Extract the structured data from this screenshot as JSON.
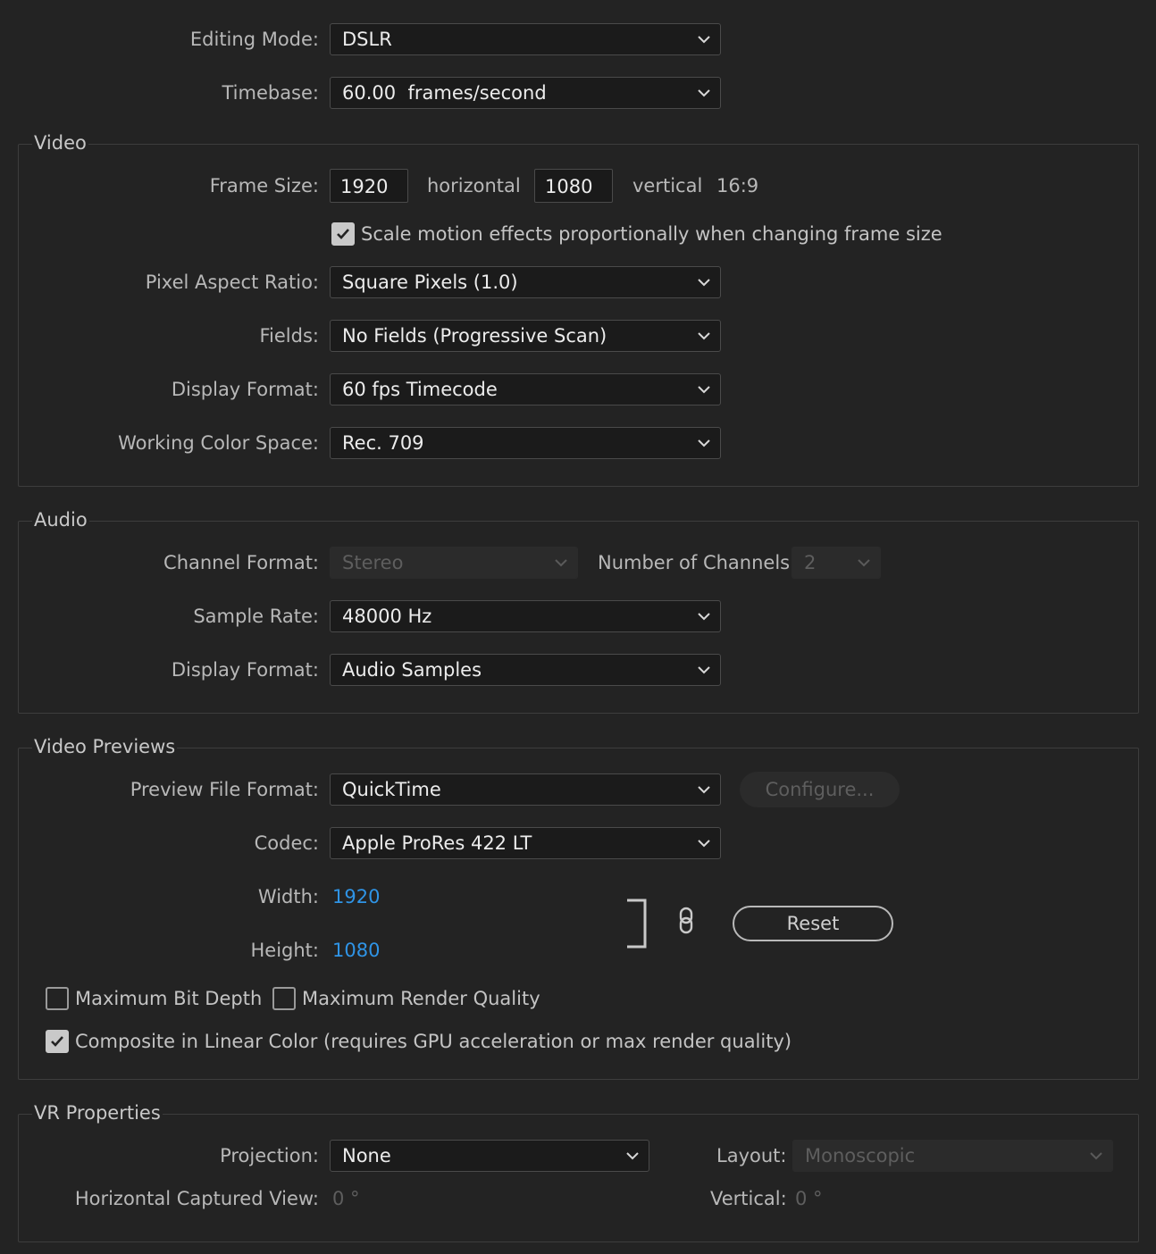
{
  "general": {
    "editing_mode_label": "Editing Mode:",
    "editing_mode_value": "DSLR",
    "timebase_label": "Timebase:",
    "timebase_value": "60.00  frames/second"
  },
  "video": {
    "title": "Video",
    "frame_size_label": "Frame Size:",
    "frame_width": "1920",
    "horizontal_label": "horizontal",
    "frame_height": "1080",
    "vertical_label": "vertical",
    "aspect_ratio": "16:9",
    "scale_motion_label": "Scale motion effects proportionally when changing frame size",
    "scale_motion_checked": true,
    "pixel_aspect_label": "Pixel Aspect Ratio:",
    "pixel_aspect_value": "Square Pixels (1.0)",
    "fields_label": "Fields:",
    "fields_value": "No Fields (Progressive Scan)",
    "display_format_label": "Display Format:",
    "display_format_value": "60 fps Timecode",
    "color_space_label": "Working Color Space:",
    "color_space_value": "Rec. 709"
  },
  "audio": {
    "title": "Audio",
    "channel_format_label": "Channel Format:",
    "channel_format_value": "Stereo",
    "num_channels_label": "Number of Channels:",
    "num_channels_value": "2",
    "sample_rate_label": "Sample Rate:",
    "sample_rate_value": "48000 Hz",
    "display_format_label": "Display Format:",
    "display_format_value": "Audio Samples"
  },
  "previews": {
    "title": "Video Previews",
    "file_format_label": "Preview File Format:",
    "file_format_value": "QuickTime",
    "configure_label": "Configure...",
    "codec_label": "Codec:",
    "codec_value": "Apple ProRes 422 LT",
    "width_label": "Width:",
    "width_value": "1920",
    "height_label": "Height:",
    "height_value": "1080",
    "reset_label": "Reset",
    "max_bit_depth_label": "Maximum Bit Depth",
    "max_bit_depth_checked": false,
    "max_render_quality_label": "Maximum Render Quality",
    "max_render_quality_checked": false,
    "linear_color_label": "Composite in Linear Color (requires GPU acceleration or max render quality)",
    "linear_color_checked": true
  },
  "vr": {
    "title": "VR Properties",
    "projection_label": "Projection:",
    "projection_value": "None",
    "layout_label": "Layout:",
    "layout_value": "Monoscopic",
    "h_view_label": "Horizontal Captured View:",
    "h_view_value": "0 °",
    "vertical_label": "Vertical:",
    "vertical_value": "0 °"
  },
  "icons": {
    "dropdown": "chevron-down-icon",
    "checkbox_check": "checkmark-icon",
    "link": "chain-link-icon",
    "bracket": "bracket-icon"
  },
  "colors": {
    "background": "#232323",
    "link_value": "#2f94e6",
    "disabled_text": "#5e5e5e"
  }
}
